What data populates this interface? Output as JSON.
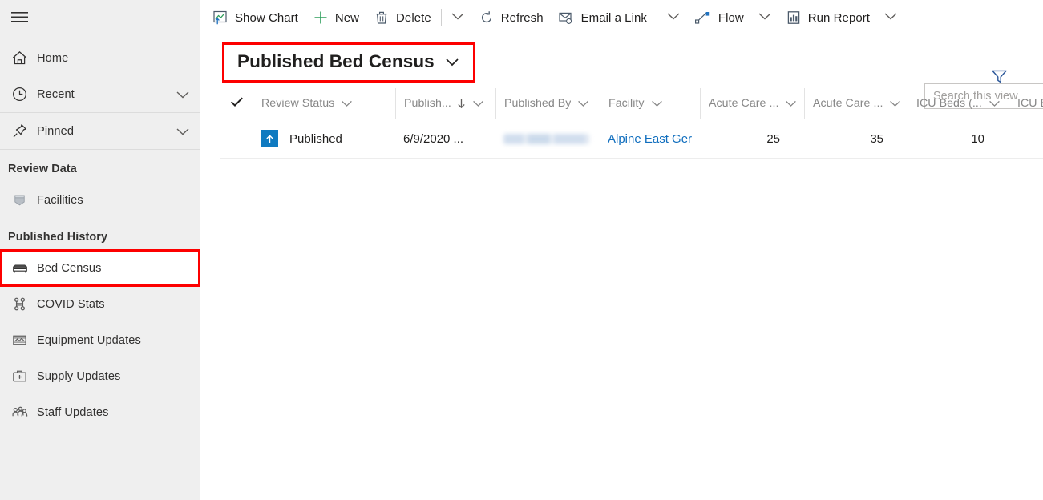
{
  "sidebar": {
    "menu_icon": "hamburger-icon",
    "top_items": [
      {
        "label": "Home",
        "icon": "home-icon",
        "chevron": false
      },
      {
        "label": "Recent",
        "icon": "clock-icon",
        "chevron": true
      },
      {
        "label": "Pinned",
        "icon": "pin-icon",
        "chevron": true
      }
    ],
    "groups": [
      {
        "header": "Review Data",
        "items": [
          {
            "label": "Facilities",
            "icon": "database-icon",
            "highlighted": false
          }
        ]
      },
      {
        "header": "Published History",
        "items": [
          {
            "label": "Bed Census",
            "icon": "bed-icon",
            "highlighted": true
          },
          {
            "label": "COVID Stats",
            "icon": "virus-icon",
            "highlighted": false
          },
          {
            "label": "Equipment Updates",
            "icon": "equipment-icon",
            "highlighted": false
          },
          {
            "label": "Supply Updates",
            "icon": "supply-icon",
            "highlighted": false
          },
          {
            "label": "Staff Updates",
            "icon": "staff-icon",
            "highlighted": false
          }
        ]
      }
    ]
  },
  "commandbar": {
    "items": [
      {
        "label": "Show Chart",
        "icon": "show-chart-icon"
      },
      {
        "label": "New",
        "icon": "plus-icon"
      },
      {
        "label": "Delete",
        "icon": "trash-icon"
      },
      {
        "label": "Refresh",
        "icon": "refresh-icon"
      },
      {
        "label": "Email a Link",
        "icon": "email-link-icon"
      },
      {
        "label": "Flow",
        "icon": "flow-icon"
      },
      {
        "label": "Run Report",
        "icon": "run-report-icon"
      }
    ]
  },
  "view": {
    "title": "Published Bed Census",
    "chevron_icon": "chevron-down-icon",
    "highlighted": true,
    "filter_icon": "filter-icon"
  },
  "search": {
    "placeholder": "Search this view",
    "value": ""
  },
  "grid": {
    "select_all_icon": "checkmark-icon",
    "columns": [
      {
        "label": "Review Status",
        "sorted": false,
        "align": "left"
      },
      {
        "label": "Publish...",
        "sorted": true,
        "sort_dir": "desc",
        "align": "left"
      },
      {
        "label": "Published By",
        "sorted": false,
        "align": "left"
      },
      {
        "label": "Facility",
        "sorted": false,
        "align": "left"
      },
      {
        "label": "Acute Care ...",
        "sorted": false,
        "align": "right"
      },
      {
        "label": "Acute Care ...",
        "sorted": false,
        "align": "right"
      },
      {
        "label": "ICU Beds (...",
        "sorted": false,
        "align": "right"
      },
      {
        "label": "ICU Be",
        "sorted": false,
        "align": "right"
      }
    ],
    "rows": [
      {
        "status": "Published",
        "status_icon": "published-up-arrow-icon",
        "published_on": "6/9/2020 ...",
        "published_by": "",
        "published_by_redacted": true,
        "facility": "Alpine East Ger",
        "acute_care_1": "25",
        "acute_care_2": "35",
        "icu_beds_1": "10",
        "icu_beds_2": ""
      }
    ]
  },
  "colors": {
    "accent_blue": "#106ebe",
    "status_blue": "#0f7ac0",
    "new_green": "#2e9e5b",
    "highlight_red": "#fd0000",
    "sidebar_bg": "#efefef"
  }
}
